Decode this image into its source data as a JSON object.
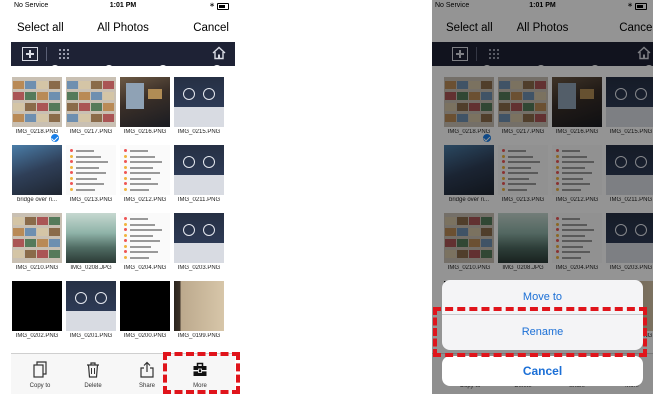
{
  "status": {
    "carrier": "No Service",
    "time": "1:01 PM"
  },
  "navbar": {
    "select_all": "Select all",
    "title": "All Photos",
    "cancel": "Cancel"
  },
  "photos": [
    {
      "name": "IMG_0218.PNG",
      "kind": "collage",
      "checked": false
    },
    {
      "name": "IMG_0217.PNG",
      "kind": "collage",
      "checked": false
    },
    {
      "name": "IMG_0216.PNG",
      "kind": "room",
      "checked": false
    },
    {
      "name": "IMG_0215.PNG",
      "kind": "dark",
      "checked": false
    },
    {
      "name": "bridge over ri...",
      "kind": "bridge",
      "checked": true
    },
    {
      "name": "IMG_0213.PNG",
      "kind": "list",
      "checked": false
    },
    {
      "name": "IMG_0212.PNG",
      "kind": "list",
      "checked": false
    },
    {
      "name": "IMG_0211.PNG",
      "kind": "dark",
      "checked": false
    },
    {
      "name": "IMG_0210.PNG",
      "kind": "collage",
      "checked": false
    },
    {
      "name": "IMG_0208.JPG",
      "kind": "city",
      "checked": false
    },
    {
      "name": "IMG_0204.PNG",
      "kind": "list",
      "checked": false
    },
    {
      "name": "IMG_0203.PNG",
      "kind": "dark",
      "checked": false
    },
    {
      "name": "IMG_0202.PNG",
      "kind": "black",
      "checked": false
    },
    {
      "name": "IMG_0201.PNG",
      "kind": "dark",
      "checked": false
    },
    {
      "name": "IMG_0200.PNG",
      "kind": "black",
      "checked": false
    },
    {
      "name": "IMG_0199.PNG",
      "kind": "wall",
      "checked": false
    }
  ],
  "tabs": {
    "copy_to": "Copy to",
    "delete": "Delete",
    "share": "Share",
    "more": "More"
  },
  "action_sheet": {
    "move_to": "Move to",
    "rename": "Rename",
    "cancel": "Cancel"
  },
  "colors": {
    "toolbar": "#1e2235",
    "accent": "#1b6fd6",
    "highlight": "#e0141b",
    "checkmark": "#1a7fe8"
  }
}
